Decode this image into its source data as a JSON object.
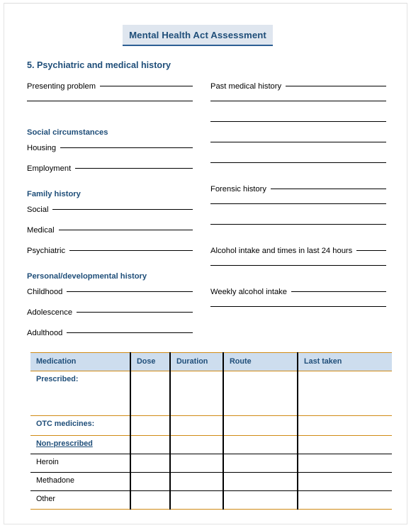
{
  "document": {
    "title": "Mental Health Act Assessment",
    "section_heading": "5. Psychiatric and medical history"
  },
  "colors": {
    "heading_blue": "#1f4e79",
    "title_background": "#dfe6ef",
    "title_underline": "#2c5f94",
    "table_header_background": "#cdddee",
    "table_rule_orange": "#d08b16",
    "rule_black": "#000000"
  },
  "left_column": [
    {
      "kind": "field",
      "label": "Presenting problem"
    },
    {
      "kind": "blank",
      "label": ""
    },
    {
      "kind": "subhead",
      "label": "Social circumstances"
    },
    {
      "kind": "field",
      "label": "Housing"
    },
    {
      "kind": "field",
      "label": "Employment"
    },
    {
      "kind": "subhead",
      "label": "Family history"
    },
    {
      "kind": "field",
      "label": "Social"
    },
    {
      "kind": "field",
      "label": "Medical"
    },
    {
      "kind": "field",
      "label": "Psychiatric"
    },
    {
      "kind": "subhead",
      "label": "Personal/developmental history"
    },
    {
      "kind": "field",
      "label": "Childhood"
    },
    {
      "kind": "field",
      "label": "Adolescence"
    },
    {
      "kind": "field",
      "label": "Adulthood"
    }
  ],
  "right_column": [
    {
      "kind": "field",
      "label": "Past medical history"
    },
    {
      "kind": "blank",
      "label": ""
    },
    {
      "kind": "blank",
      "label": ""
    },
    {
      "kind": "blank",
      "label": ""
    },
    {
      "kind": "blank",
      "label": ""
    },
    {
      "kind": "field",
      "label": "Forensic history"
    },
    {
      "kind": "blank",
      "label": ""
    },
    {
      "kind": "blank",
      "label": ""
    },
    {
      "kind": "field",
      "label": "Alcohol intake and times in last 24 hours"
    },
    {
      "kind": "blank",
      "label": ""
    },
    {
      "kind": "field",
      "label": "Weekly alcohol intake"
    },
    {
      "kind": "blank",
      "label": ""
    }
  ],
  "medication_table": {
    "columns": [
      "Medication",
      "Dose",
      "Duration",
      "Route",
      "Last taken"
    ],
    "rows": [
      {
        "label": "Prescribed:",
        "style": "blue",
        "cells": [
          "",
          "",
          "",
          ""
        ]
      },
      {
        "label": "OTC medicines:",
        "style": "blue",
        "cells": [
          "",
          "",
          "",
          ""
        ]
      },
      {
        "label": "Non-prescribed",
        "style": "blue-underline",
        "cells": [
          "",
          "",
          "",
          ""
        ]
      },
      {
        "label": "Heroin",
        "style": "black",
        "cells": [
          "",
          "",
          "",
          ""
        ]
      },
      {
        "label": "Methadone",
        "style": "black",
        "cells": [
          "",
          "",
          "",
          ""
        ]
      },
      {
        "label": "Other",
        "style": "black",
        "cells": [
          "",
          "",
          "",
          ""
        ]
      }
    ]
  }
}
